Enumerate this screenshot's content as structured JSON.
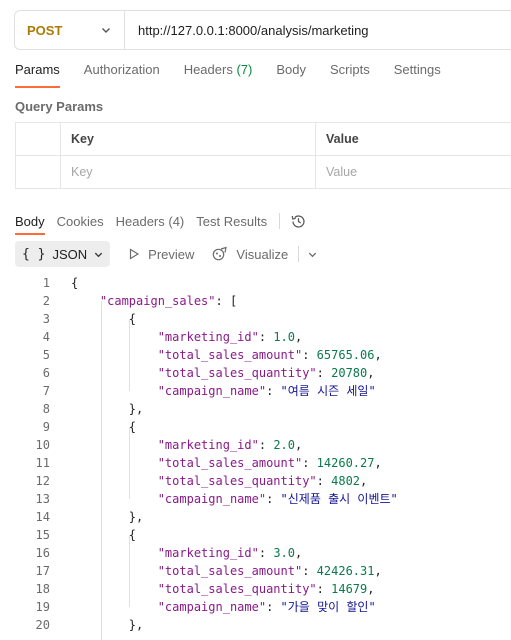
{
  "request": {
    "method": "POST",
    "url": "http://127.0.0.1:8000/analysis/marketing"
  },
  "request_tabs": [
    {
      "label": "Params",
      "count": ""
    },
    {
      "label": "Authorization",
      "count": ""
    },
    {
      "label": "Headers",
      "count": "(7)"
    },
    {
      "label": "Body",
      "count": ""
    },
    {
      "label": "Scripts",
      "count": ""
    },
    {
      "label": "Settings",
      "count": ""
    }
  ],
  "query_params": {
    "title": "Query Params",
    "key_header": "Key",
    "value_header": "Value",
    "key_placeholder": "Key",
    "value_placeholder": "Value"
  },
  "response_tabs": [
    {
      "label": "Body",
      "count": ""
    },
    {
      "label": "Cookies",
      "count": ""
    },
    {
      "label": "Headers",
      "count": "(4)"
    },
    {
      "label": "Test Results",
      "count": ""
    }
  ],
  "view": {
    "format_braces": "{ }",
    "format": "JSON",
    "preview": "Preview",
    "visualize": "Visualize"
  },
  "code_lines": [
    {
      "n": "1",
      "t": "{"
    },
    {
      "n": "2",
      "t": "    \"campaign_sales\": ["
    },
    {
      "n": "3",
      "t": "        {"
    },
    {
      "n": "4",
      "t": "            \"marketing_id\": 1.0,"
    },
    {
      "n": "5",
      "t": "            \"total_sales_amount\": 65765.06,"
    },
    {
      "n": "6",
      "t": "            \"total_sales_quantity\": 20780,"
    },
    {
      "n": "7",
      "t": "            \"campaign_name\": \"여름 시즌 세일\""
    },
    {
      "n": "8",
      "t": "        },"
    },
    {
      "n": "9",
      "t": "        {"
    },
    {
      "n": "10",
      "t": "            \"marketing_id\": 2.0,"
    },
    {
      "n": "11",
      "t": "            \"total_sales_amount\": 14260.27,"
    },
    {
      "n": "12",
      "t": "            \"total_sales_quantity\": 4802,"
    },
    {
      "n": "13",
      "t": "            \"campaign_name\": \"신제품 출시 이벤트\""
    },
    {
      "n": "14",
      "t": "        },"
    },
    {
      "n": "15",
      "t": "        {"
    },
    {
      "n": "16",
      "t": "            \"marketing_id\": 3.0,"
    },
    {
      "n": "17",
      "t": "            \"total_sales_amount\": 42426.31,"
    },
    {
      "n": "18",
      "t": "            \"total_sales_quantity\": 14679,"
    },
    {
      "n": "19",
      "t": "            \"campaign_name\": \"가을 맞이 할인\""
    },
    {
      "n": "20",
      "t": "        },"
    }
  ],
  "colors": {
    "method": "#ad7a03",
    "accent": "#ff6c37",
    "json_key": "#8a1a8a",
    "json_string": "#141494",
    "json_number": "#0b7a4b"
  },
  "icons": {
    "method_dropdown": "chevron-down-icon",
    "history": "history-icon",
    "format_dropdown": "chevron-down-icon",
    "preview": "play-icon",
    "visualize": "visualize-icon"
  }
}
